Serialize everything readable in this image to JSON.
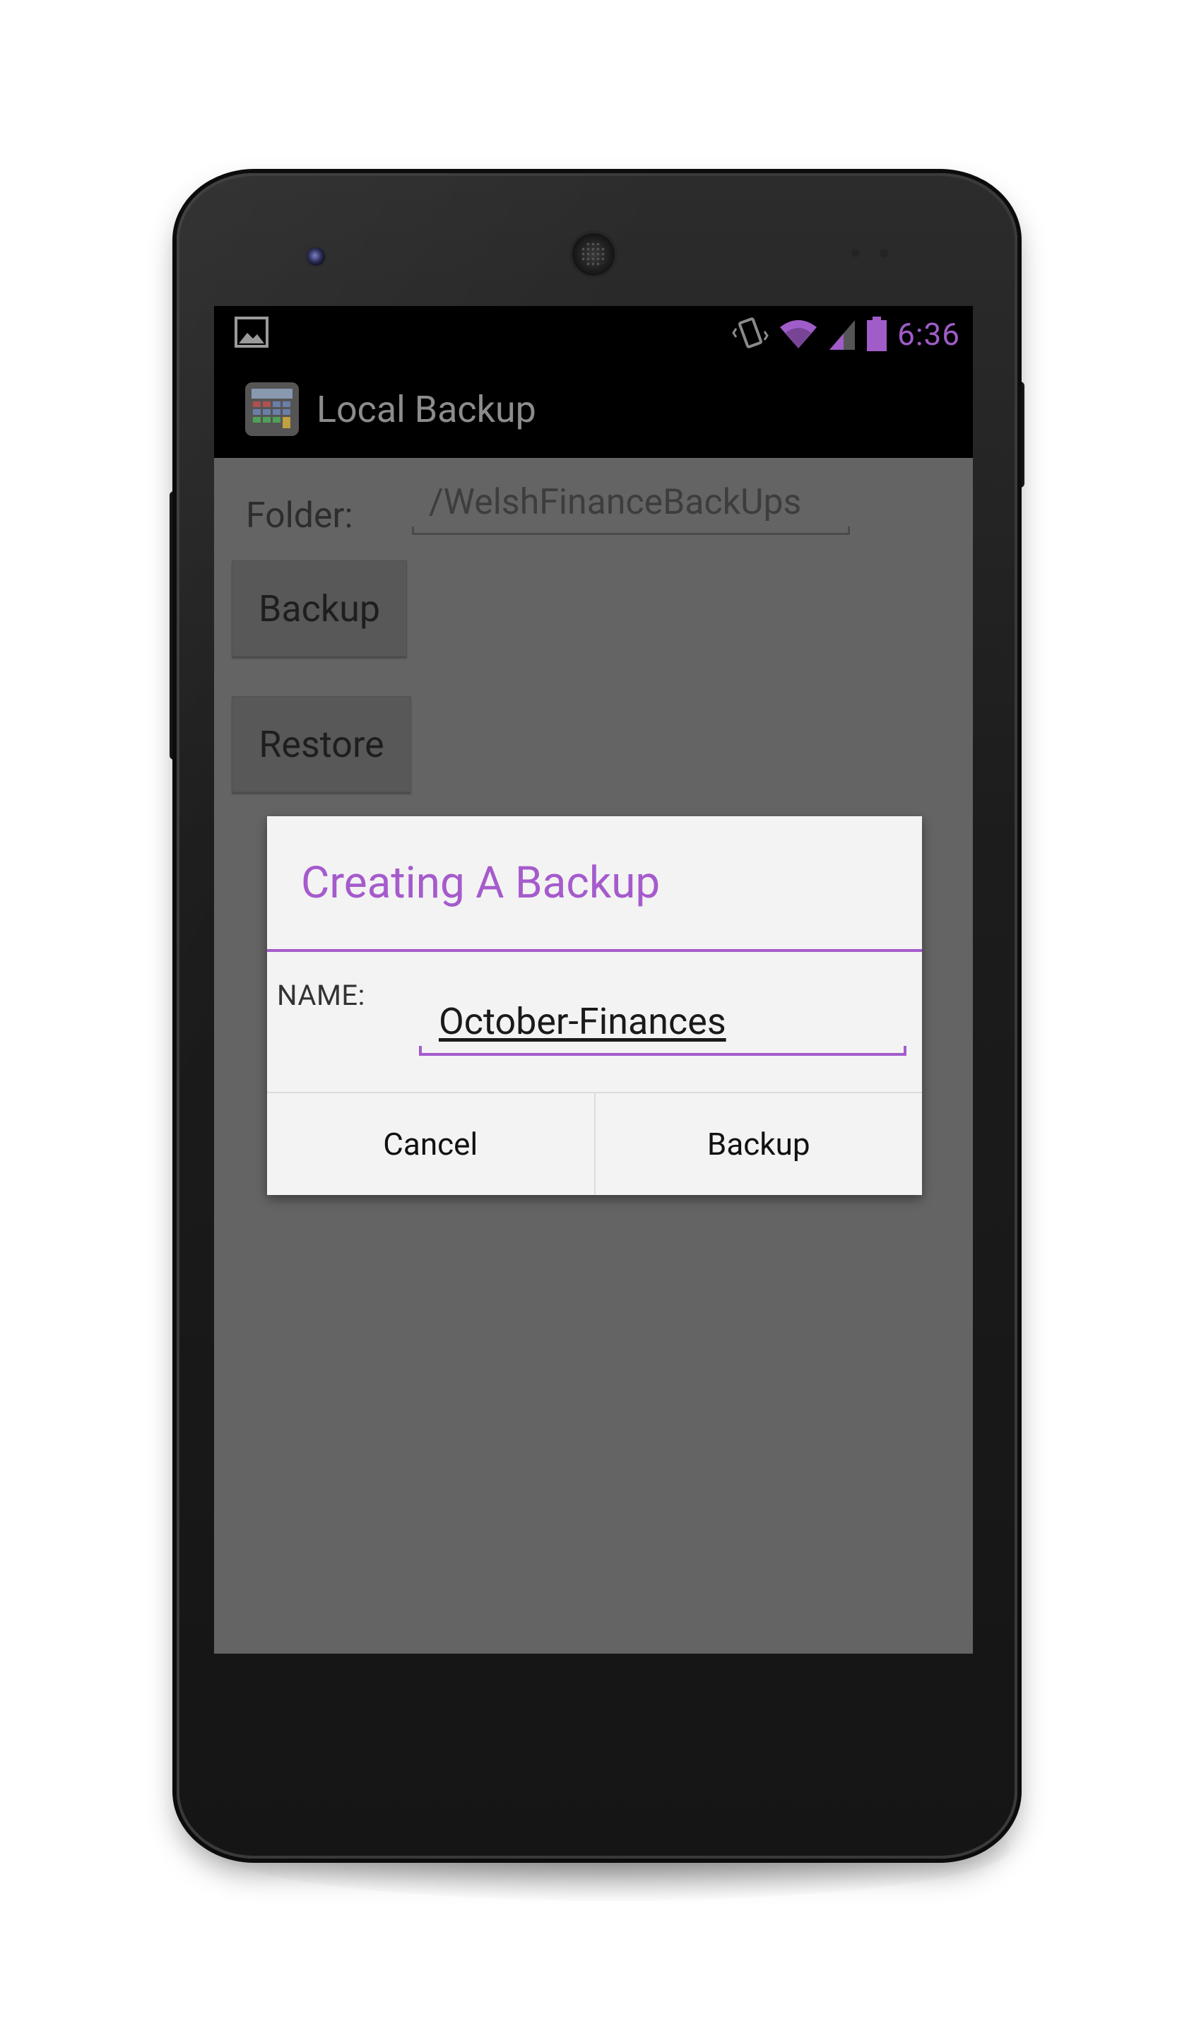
{
  "status_bar": {
    "time": "6:36",
    "icons": [
      "gallery-notification-icon",
      "vibrate-icon",
      "wifi-icon",
      "signal-icon",
      "battery-icon"
    ],
    "accent_color": "#a05cc8"
  },
  "action_bar": {
    "app_icon": "calculator-app-icon",
    "title": "Local Backup"
  },
  "main": {
    "folder_label": "Folder:",
    "folder_value": "/WelshFinanceBackUps",
    "backup_button": "Backup",
    "restore_button": "Restore"
  },
  "dialog": {
    "title": "Creating A Backup",
    "name_label": "NAME:",
    "name_value": "October-Finances",
    "cancel_button": "Cancel",
    "confirm_button": "Backup",
    "accent_color": "#a55bcc"
  }
}
